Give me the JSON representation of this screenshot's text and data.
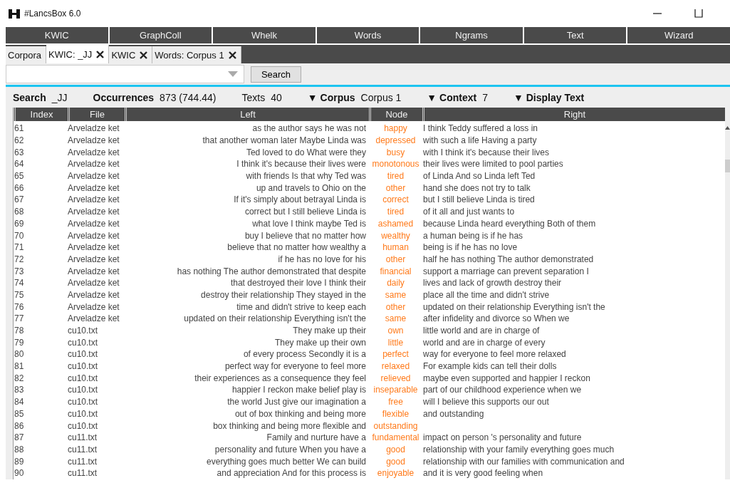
{
  "window": {
    "title": "#LancsBox 6.0"
  },
  "nav": [
    {
      "label": "KWIC"
    },
    {
      "label": "GraphColl"
    },
    {
      "label": "Whelk"
    },
    {
      "label": "Words"
    },
    {
      "label": "Ngrams"
    },
    {
      "label": "Text"
    },
    {
      "label": "Wizard"
    }
  ],
  "tabs": [
    {
      "label": "Corpora",
      "selected": false,
      "closable": false
    },
    {
      "label": "KWIC: _JJ",
      "selected": true,
      "closable": true
    },
    {
      "label": "KWIC",
      "selected": false,
      "closable": true
    },
    {
      "label": "Words: Corpus 1",
      "selected": false,
      "closable": true
    }
  ],
  "search": {
    "button": "Search"
  },
  "info": [
    {
      "label": "Search",
      "value": "_JJ"
    },
    {
      "label": "Occurrences",
      "value": "873 (744.44)"
    },
    {
      "label": "Texts",
      "value": "40",
      "kind": "plain"
    },
    {
      "label": "▼ Corpus",
      "value": "Corpus 1"
    },
    {
      "label": "▼ Context",
      "value": "7"
    },
    {
      "label": "▼ Display Text"
    }
  ],
  "table": {
    "columns": [
      "Index",
      "File",
      "Left",
      "Node",
      "Right"
    ],
    "rows": [
      [
        "61",
        "Arveladze ket",
        "as the author says he was not",
        "happy",
        "I think Teddy suffered a loss in"
      ],
      [
        "62",
        "Arveladze ket",
        "that another woman later Maybe Linda was",
        "depressed",
        "with such a life Having a party"
      ],
      [
        "63",
        "Arveladze ket",
        "Ted loved to do What were they",
        "busy",
        "with I think it's because their lives"
      ],
      [
        "64",
        "Arveladze ket",
        "I think it's because their lives were",
        "monotonous",
        "their lives were limited to pool parties"
      ],
      [
        "65",
        "Arveladze ket",
        "with friends Is that why Ted was",
        "tired",
        "of Linda And so Linda left Ted"
      ],
      [
        "66",
        "Arveladze ket",
        "up and travels to Ohio on the",
        "other",
        "hand she does not try to talk"
      ],
      [
        "67",
        "Arveladze ket",
        "If it's simply about betrayal Linda is",
        "correct",
        "but I still believe Linda is tired"
      ],
      [
        "68",
        "Arveladze ket",
        "correct but I still believe Linda is",
        "tired",
        "of it all and just wants to"
      ],
      [
        "69",
        "Arveladze ket",
        "what love I think maybe Ted is",
        "ashamed",
        "because Linda heard everything Both of them"
      ],
      [
        "70",
        "Arveladze ket",
        "buy I believe that no matter how",
        "wealthy",
        "a human being is if he has"
      ],
      [
        "71",
        "Arveladze ket",
        "believe that no matter how wealthy a",
        "human",
        "being is if he has no love"
      ],
      [
        "72",
        "Arveladze ket",
        "if he has no love for his",
        "other",
        "half he has nothing The author demonstrated"
      ],
      [
        "73",
        "Arveladze ket",
        "has nothing The author demonstrated that despite",
        "financial",
        "support a marriage can prevent separation I"
      ],
      [
        "74",
        "Arveladze ket",
        "that destroyed their love I think their",
        "daily",
        "lives and lack of growth destroy their"
      ],
      [
        "75",
        "Arveladze ket",
        "destroy their relationship They stayed in the",
        "same",
        "place all the time and didn't strive"
      ],
      [
        "76",
        "Arveladze ket",
        "time and didn't strive to keep each",
        "other",
        "updated on their relationship Everything isn't the"
      ],
      [
        "77",
        "Arveladze ket",
        "updated on their relationship Everything isn't the",
        "same",
        "after infidelity and divorce so When we"
      ],
      [
        "78",
        "cu10.txt",
        "They make up their",
        "own",
        "little world and are in charge of"
      ],
      [
        "79",
        "cu10.txt",
        "They make up their own",
        "little",
        "world and are in charge of every"
      ],
      [
        "80",
        "cu10.txt",
        "of every process Secondly it is a",
        "perfect",
        "way for everyone to feel more relaxed"
      ],
      [
        "81",
        "cu10.txt",
        "perfect way for everyone to feel more",
        "relaxed",
        "For example kids can tell their dolls"
      ],
      [
        "82",
        "cu10.txt",
        "their experiences as a consequence they feel",
        "relieved",
        "maybe even supported and happier I reckon"
      ],
      [
        "83",
        "cu10.txt",
        "happier I reckon make belief play is",
        "inseparable",
        "part of our childhood experience when we"
      ],
      [
        "84",
        "cu10.txt",
        "the world Just give our imagination a",
        "free",
        "will I believe this supports our out"
      ],
      [
        "85",
        "cu10.txt",
        "out of box thinking and being more",
        "flexible",
        "and outstanding"
      ],
      [
        "86",
        "cu10.txt",
        "box thinking and being more flexible and",
        "outstanding",
        ""
      ],
      [
        "87",
        "cu11.txt",
        "Family and nurture have a",
        "fundamental",
        "impact on person 's personality and future"
      ],
      [
        "88",
        "cu11.txt",
        "personality and future When you have a",
        "good",
        "relationship with your family everything goes much"
      ],
      [
        "89",
        "cu11.txt",
        "everything goes much better We can build",
        "good",
        "relationship with our families with communication and"
      ],
      [
        "90",
        "cu11.txt",
        "and appreciation And for this process is",
        "enjoyable",
        "and it is very good feeling when"
      ]
    ]
  }
}
